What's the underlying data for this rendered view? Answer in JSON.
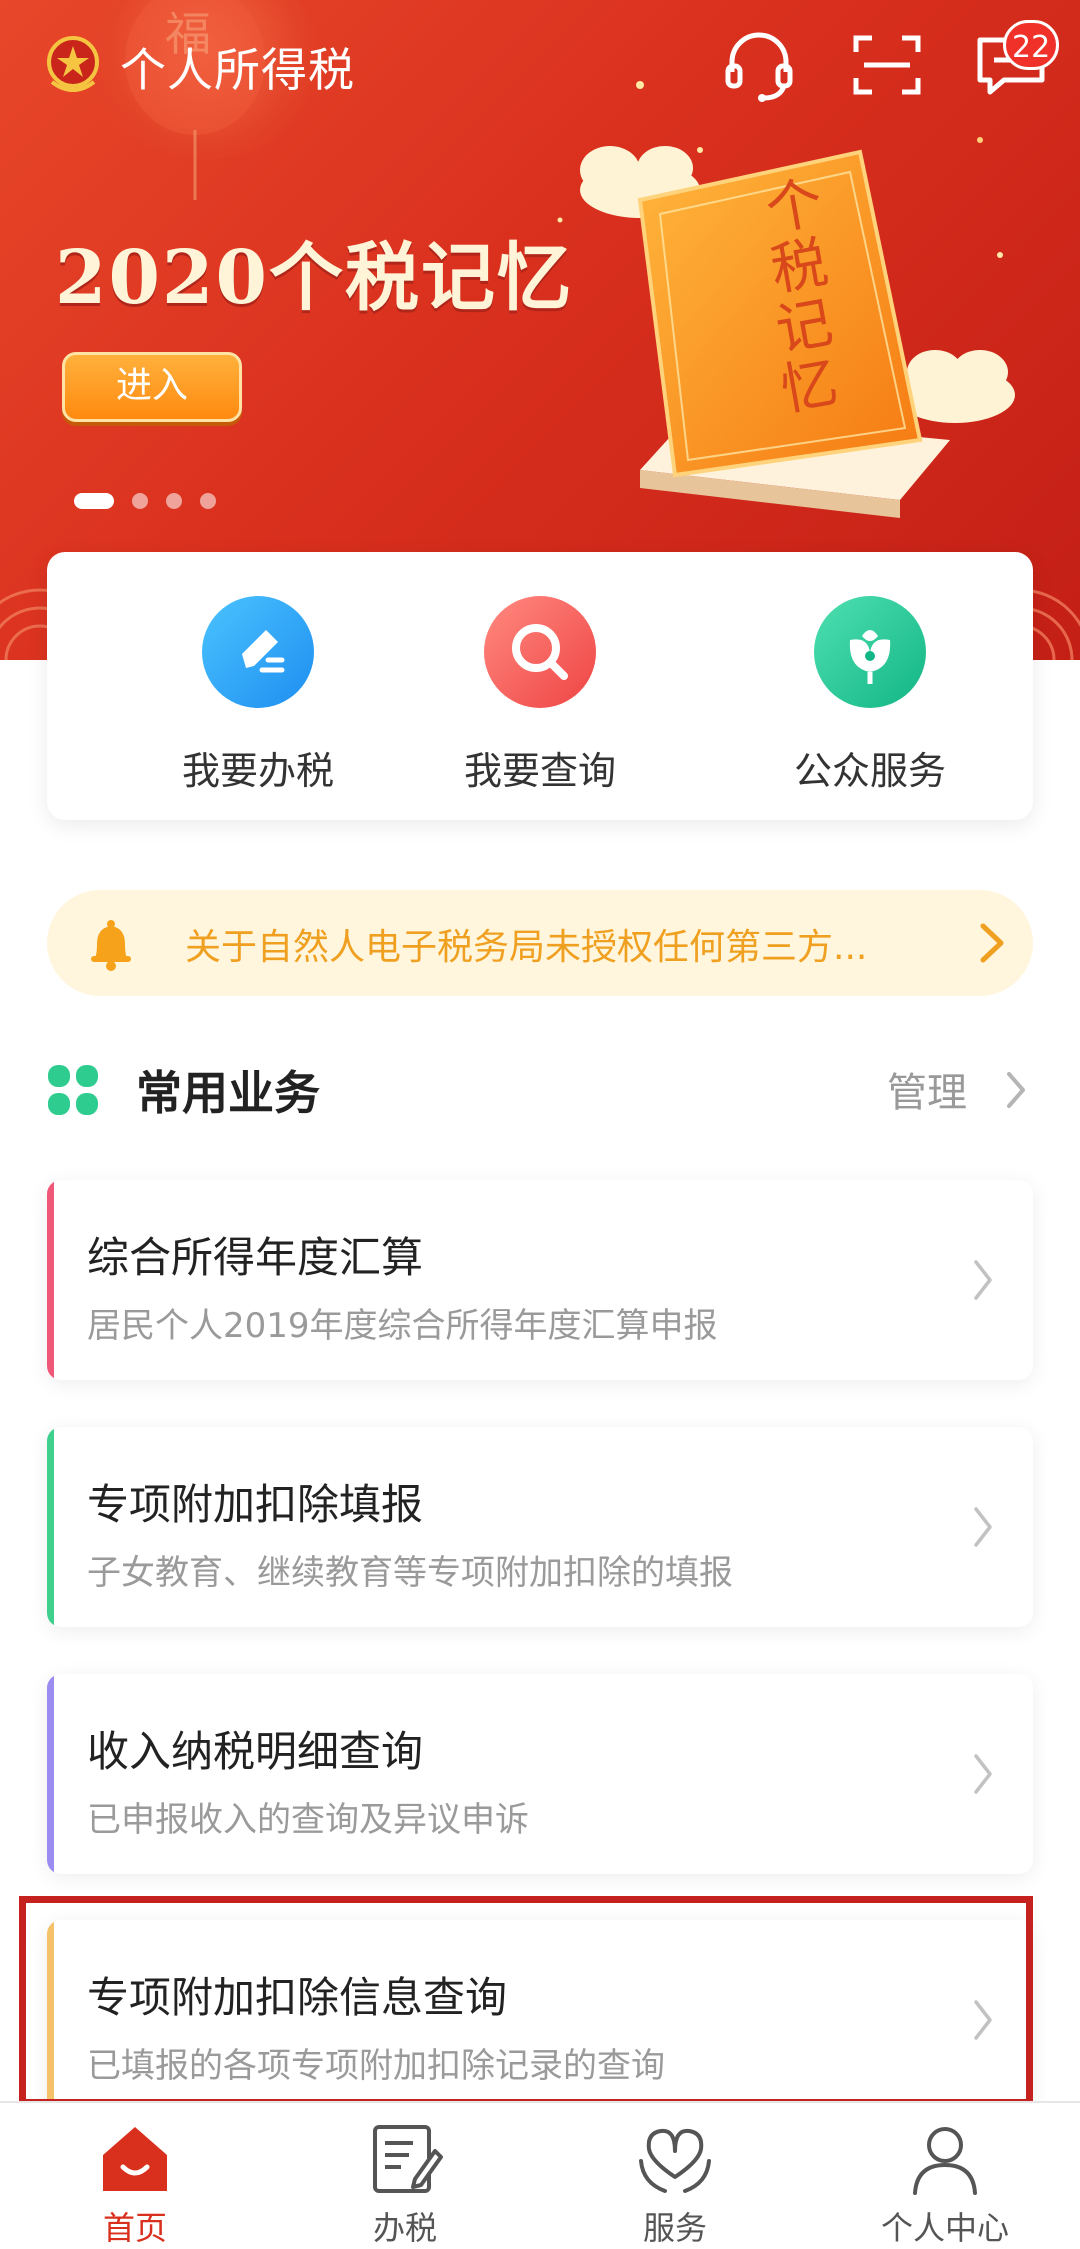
{
  "header": {
    "app_title": "个人所得税",
    "message_count": "22",
    "icons": [
      "emblem-icon",
      "customer-service-icon",
      "scan-icon",
      "message-icon"
    ]
  },
  "banner": {
    "title": "2020个税记忆",
    "enter_label": "进入",
    "book_text": "个税记忆",
    "lantern_text": "福",
    "slide_count": 4,
    "active_slide": 1
  },
  "quick_actions": [
    {
      "label": "我要办税",
      "icon": "edit-icon",
      "color": "#2aa6f5"
    },
    {
      "label": "我要查询",
      "icon": "search-icon",
      "color": "#f25a55"
    },
    {
      "label": "公众服务",
      "icon": "flower-icon",
      "color": "#27c79a"
    }
  ],
  "notice": {
    "text": "关于自然人电子税务局未授权任何第三方...",
    "icon": "bell-icon"
  },
  "common_services": {
    "title": "常用业务",
    "manage_label": "管理",
    "items": [
      {
        "title": "综合所得年度汇算",
        "desc": "居民个人2019年度综合所得年度汇算申报",
        "accent": "#f0587a"
      },
      {
        "title": "专项附加扣除填报",
        "desc": "子女教育、继续教育等专项附加扣除的填报",
        "accent": "#3fd08e"
      },
      {
        "title": "收入纳税明细查询",
        "desc": "已申报收入的查询及异议申诉",
        "accent": "#9b8cf2"
      },
      {
        "title": "专项附加扣除信息查询",
        "desc": "已填报的各项专项附加扣除记录的查询",
        "accent": "#f5c26a"
      }
    ]
  },
  "nav": [
    {
      "label": "首页",
      "icon": "home-icon",
      "active": true
    },
    {
      "label": "办税",
      "icon": "tax-form-icon",
      "active": false
    },
    {
      "label": "服务",
      "icon": "service-heart-icon",
      "active": false
    },
    {
      "label": "个人中心",
      "icon": "profile-icon",
      "active": false
    }
  ],
  "colors": {
    "brand_red": "#d9301e",
    "highlight": "#c5221f",
    "notice_text": "#f0a020"
  }
}
